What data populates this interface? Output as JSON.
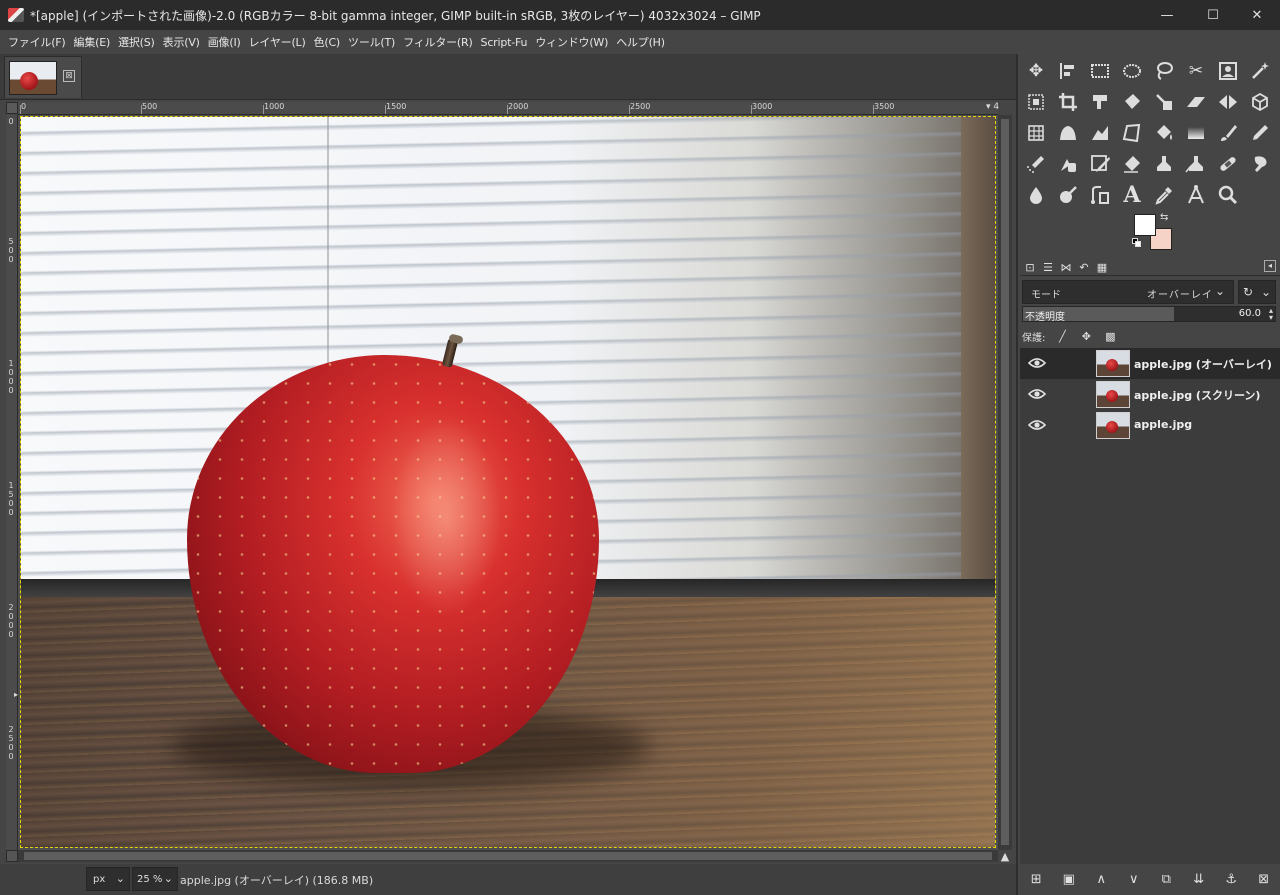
{
  "window": {
    "title": "*[apple] (インポートされた画像)-2.0 (RGBカラー 8-bit gamma integer, GIMP built-in sRGB, 3枚のレイヤー) 4032x3024 – GIMP",
    "minimize": "—",
    "maximize": "☐",
    "close": "✕"
  },
  "menu": [
    "ファイル(F)",
    "編集(E)",
    "選択(S)",
    "表示(V)",
    "画像(I)",
    "レイヤー(L)",
    "色(C)",
    "ツール(T)",
    "フィルター(R)",
    "Script-Fu",
    "ウィンドウ(W)",
    "ヘルプ(H)"
  ],
  "tab": {
    "close_glyph": "⊠"
  },
  "ruler": {
    "top_labels": [
      "0",
      "500",
      "1000",
      "1500",
      "2000",
      "2500",
      "3000",
      "3500"
    ],
    "top_end": "▾ 4",
    "left_labels": [
      "0",
      "500",
      "1000",
      "1500",
      "2000",
      "2500"
    ]
  },
  "statusbar": {
    "unit": "px",
    "zoom": "25 %",
    "message": "apple.jpg (オーバーレイ) (186.8 MB)"
  },
  "colors": {
    "foreground": "#ffffff",
    "background": "#f5d3c6",
    "selection": "#e8d400"
  },
  "layers_panel": {
    "mode_label": "モード",
    "mode_value": "オーバーレイ",
    "opacity_label": "不透明度",
    "opacity_value": "60.0",
    "opacity_fraction": 0.6,
    "lock_label": "保護:",
    "layers": [
      {
        "name": "apple.jpg (オーバーレイ)",
        "visible": true,
        "selected": true
      },
      {
        "name": "apple.jpg (スクリーン)",
        "visible": true,
        "selected": false
      },
      {
        "name": "apple.jpg",
        "visible": true,
        "selected": false
      }
    ]
  }
}
